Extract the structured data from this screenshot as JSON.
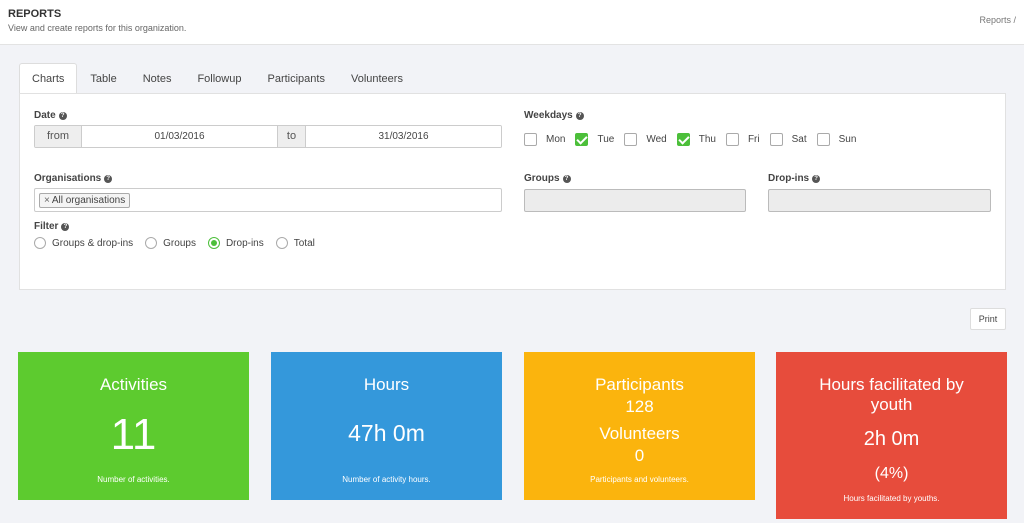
{
  "header": {
    "title": "REPORTS",
    "subtitle": "View and create reports for this organization.",
    "breadcrumb": "Reports /"
  },
  "tabs": [
    {
      "label": "Charts",
      "active": true
    },
    {
      "label": "Table"
    },
    {
      "label": "Notes"
    },
    {
      "label": "Followup"
    },
    {
      "label": "Participants"
    },
    {
      "label": "Volunteers"
    }
  ],
  "filters": {
    "date_label": "Date",
    "from_label": "from",
    "from_value": "01/03/2016",
    "to_label": "to",
    "to_value": "31/03/2016",
    "weekdays_label": "Weekdays",
    "weekdays": [
      {
        "label": "Mon",
        "checked": false
      },
      {
        "label": "Tue",
        "checked": true
      },
      {
        "label": "Wed",
        "checked": false
      },
      {
        "label": "Thu",
        "checked": true
      },
      {
        "label": "Fri",
        "checked": false
      },
      {
        "label": "Sat",
        "checked": false
      },
      {
        "label": "Sun",
        "checked": false
      }
    ],
    "organisations_label": "Organisations",
    "organisations_tag": "All organisations",
    "groups_label": "Groups",
    "dropins_label": "Drop-ins",
    "filter_label": "Filter",
    "filter_options": [
      {
        "label": "Groups & drop-ins",
        "selected": false
      },
      {
        "label": "Groups",
        "selected": false
      },
      {
        "label": "Drop-ins",
        "selected": true
      },
      {
        "label": "Total",
        "selected": false
      }
    ]
  },
  "print_label": "Print",
  "cards": {
    "activities": {
      "title": "Activities",
      "value": "11",
      "footer": "Number of activities.",
      "color": "#5dcb2f"
    },
    "hours": {
      "title": "Hours",
      "value": "47h 0m",
      "footer": "Number of activity hours.",
      "color": "#3498db"
    },
    "people": {
      "participants_title": "Participants",
      "participants_value": "128",
      "volunteers_title": "Volunteers",
      "volunteers_value": "0",
      "footer": "Participants and volunteers.",
      "color": "#fbb40d"
    },
    "youth": {
      "title_line1": "Hours facilitated by",
      "title_line2": "youth",
      "value": "2h 0m",
      "percent": "(4%)",
      "footer": "Hours facilitated by youths.",
      "color": "#e74c3c"
    }
  }
}
